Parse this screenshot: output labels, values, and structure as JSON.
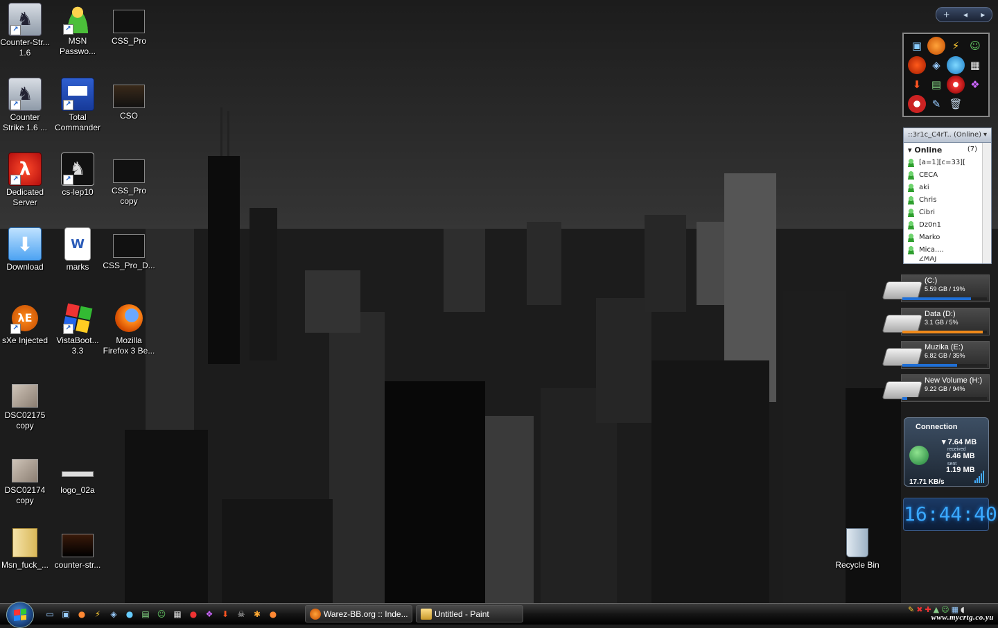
{
  "desktop": {
    "icons": [
      {
        "label": "Counter-Str... 1.6"
      },
      {
        "label": "MSN Passwo..."
      },
      {
        "label": "CSS_Pro"
      },
      {
        "label": "Counter Strike 1.6 ..."
      },
      {
        "label": "Total Commander"
      },
      {
        "label": "CSO"
      },
      {
        "label": "Dedicated Server"
      },
      {
        "label": "cs-lep10"
      },
      {
        "label": "CSS_Pro copy"
      },
      {
        "label": "Download"
      },
      {
        "label": "marks"
      },
      {
        "label": "CSS_Pro_D..."
      },
      {
        "label": "sXe Injected"
      },
      {
        "label": "VistaBoot... 3.3"
      },
      {
        "label": "Mozilla Firefox 3 Be..."
      },
      {
        "label": "DSC02175 copy"
      },
      {
        "label": "DSC02174 copy"
      },
      {
        "label": "logo_02a"
      },
      {
        "label": "Msn_fuck_..."
      },
      {
        "label": "counter-str..."
      },
      {
        "label": "Recycle Bin"
      }
    ]
  },
  "sidebar": {
    "controls": {
      "add": "+",
      "prev": "◂",
      "next": "▸"
    }
  },
  "msn": {
    "status_header": "::3r1c_C4rT.. (Online)",
    "group_label": "Online",
    "group_count": "(7)",
    "contacts": [
      "[a=1][c=33][",
      "CECA",
      "aki",
      "Chris",
      "Cibri",
      "Dz0n1",
      "Marko",
      "Mica....",
      "ZMAJ"
    ]
  },
  "drives": [
    {
      "name": "(C:)",
      "info": "5.59 GB / 19%",
      "fill": 0.81,
      "color": "#1f6fd6"
    },
    {
      "name": "Data (D:)",
      "info": "3.1 GB / 5%",
      "fill": 0.95,
      "color": "#f08a1a"
    },
    {
      "name": "Muzika (E:)",
      "info": "6.82 GB / 35%",
      "fill": 0.65,
      "color": "#1f6fd6"
    },
    {
      "name": "New Volume (H:)",
      "info": "9.22 GB / 94%",
      "fill": 0.06,
      "color": "#1f6fd6"
    }
  ],
  "connection": {
    "title": "Connection",
    "total": "7.64 MB",
    "received_label": "received",
    "received": "6.46 MB",
    "sent_label": "sent",
    "sent": "1.19 MB",
    "speed": "17.71 KB/s"
  },
  "clock": {
    "time": "16:44:40"
  },
  "taskbar": {
    "tasks": [
      {
        "label": "Warez-BB.org :: Inde..."
      },
      {
        "label": "Untitled - Paint"
      }
    ],
    "tray_text": "www.mycrtg.co.yu"
  }
}
